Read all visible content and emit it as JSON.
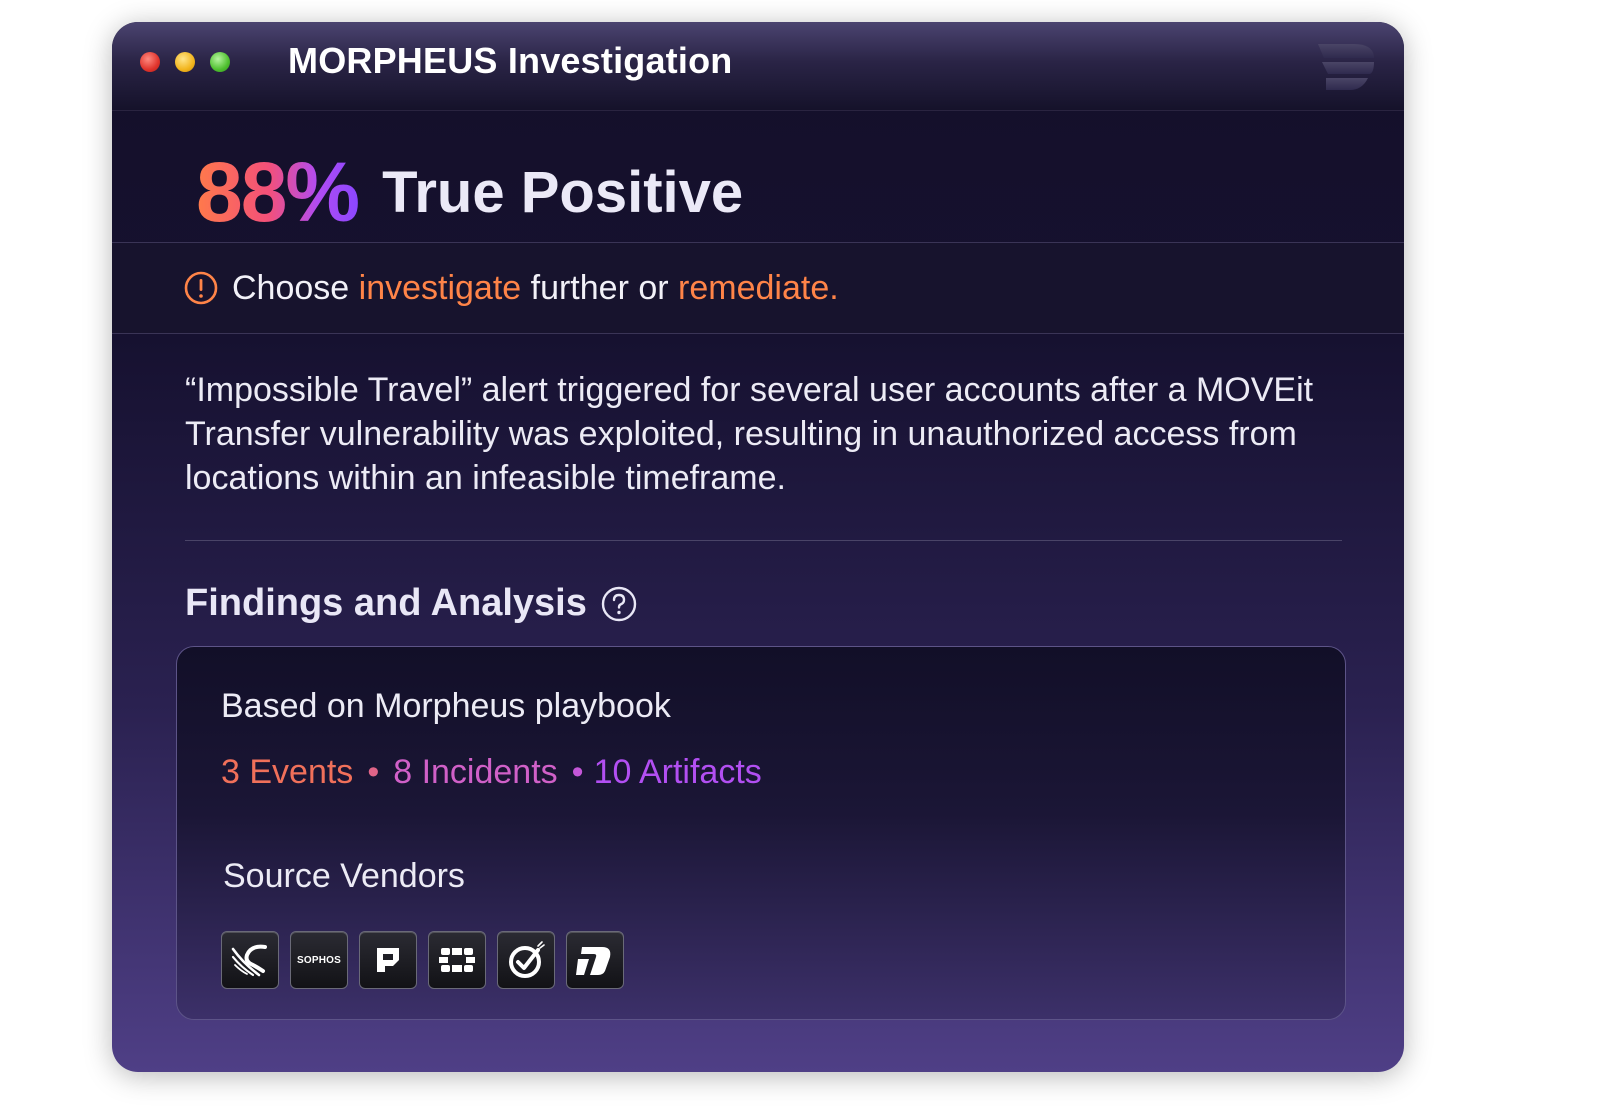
{
  "window": {
    "title": "MORPHEUS Investigation",
    "controls": [
      "close",
      "minimize",
      "zoom"
    ],
    "logo_icon": "d3-logo-icon"
  },
  "verdict": {
    "confidence": "88%",
    "label": "True Positive"
  },
  "prompt": {
    "icon": "alert-circle-icon",
    "prefix": "Choose ",
    "action1": "investigate",
    "middle": " further or ",
    "action2": "remediate."
  },
  "description": "“Impossible Travel” alert triggered for several user accounts after a MOVEit Transfer vulnerability was exploited, resulting in unauthorized access from locations within an infeasible timeframe.",
  "findings": {
    "title": "Findings and Analysis",
    "help_icon": "help-circle-icon",
    "playbook_label": "Based on Morpheus playbook",
    "events": "3 Events",
    "incidents": "8 Incidents",
    "artifacts": "10 Artifacts",
    "separator": "•",
    "vendors_label": "Source Vendors",
    "vendors": [
      {
        "icon": "crowdstrike-icon"
      },
      {
        "label": "SOPHOS"
      },
      {
        "icon": "paloalto-icon"
      },
      {
        "icon": "fortinet-icon"
      },
      {
        "icon": "checkmark-vendor-icon"
      },
      {
        "icon": "d7-vendor-icon"
      }
    ]
  },
  "colors": {
    "accent_orange": "#ff8448",
    "events": "#f0705a",
    "incidents": "#d060c8",
    "artifacts": "#b24ff2"
  }
}
